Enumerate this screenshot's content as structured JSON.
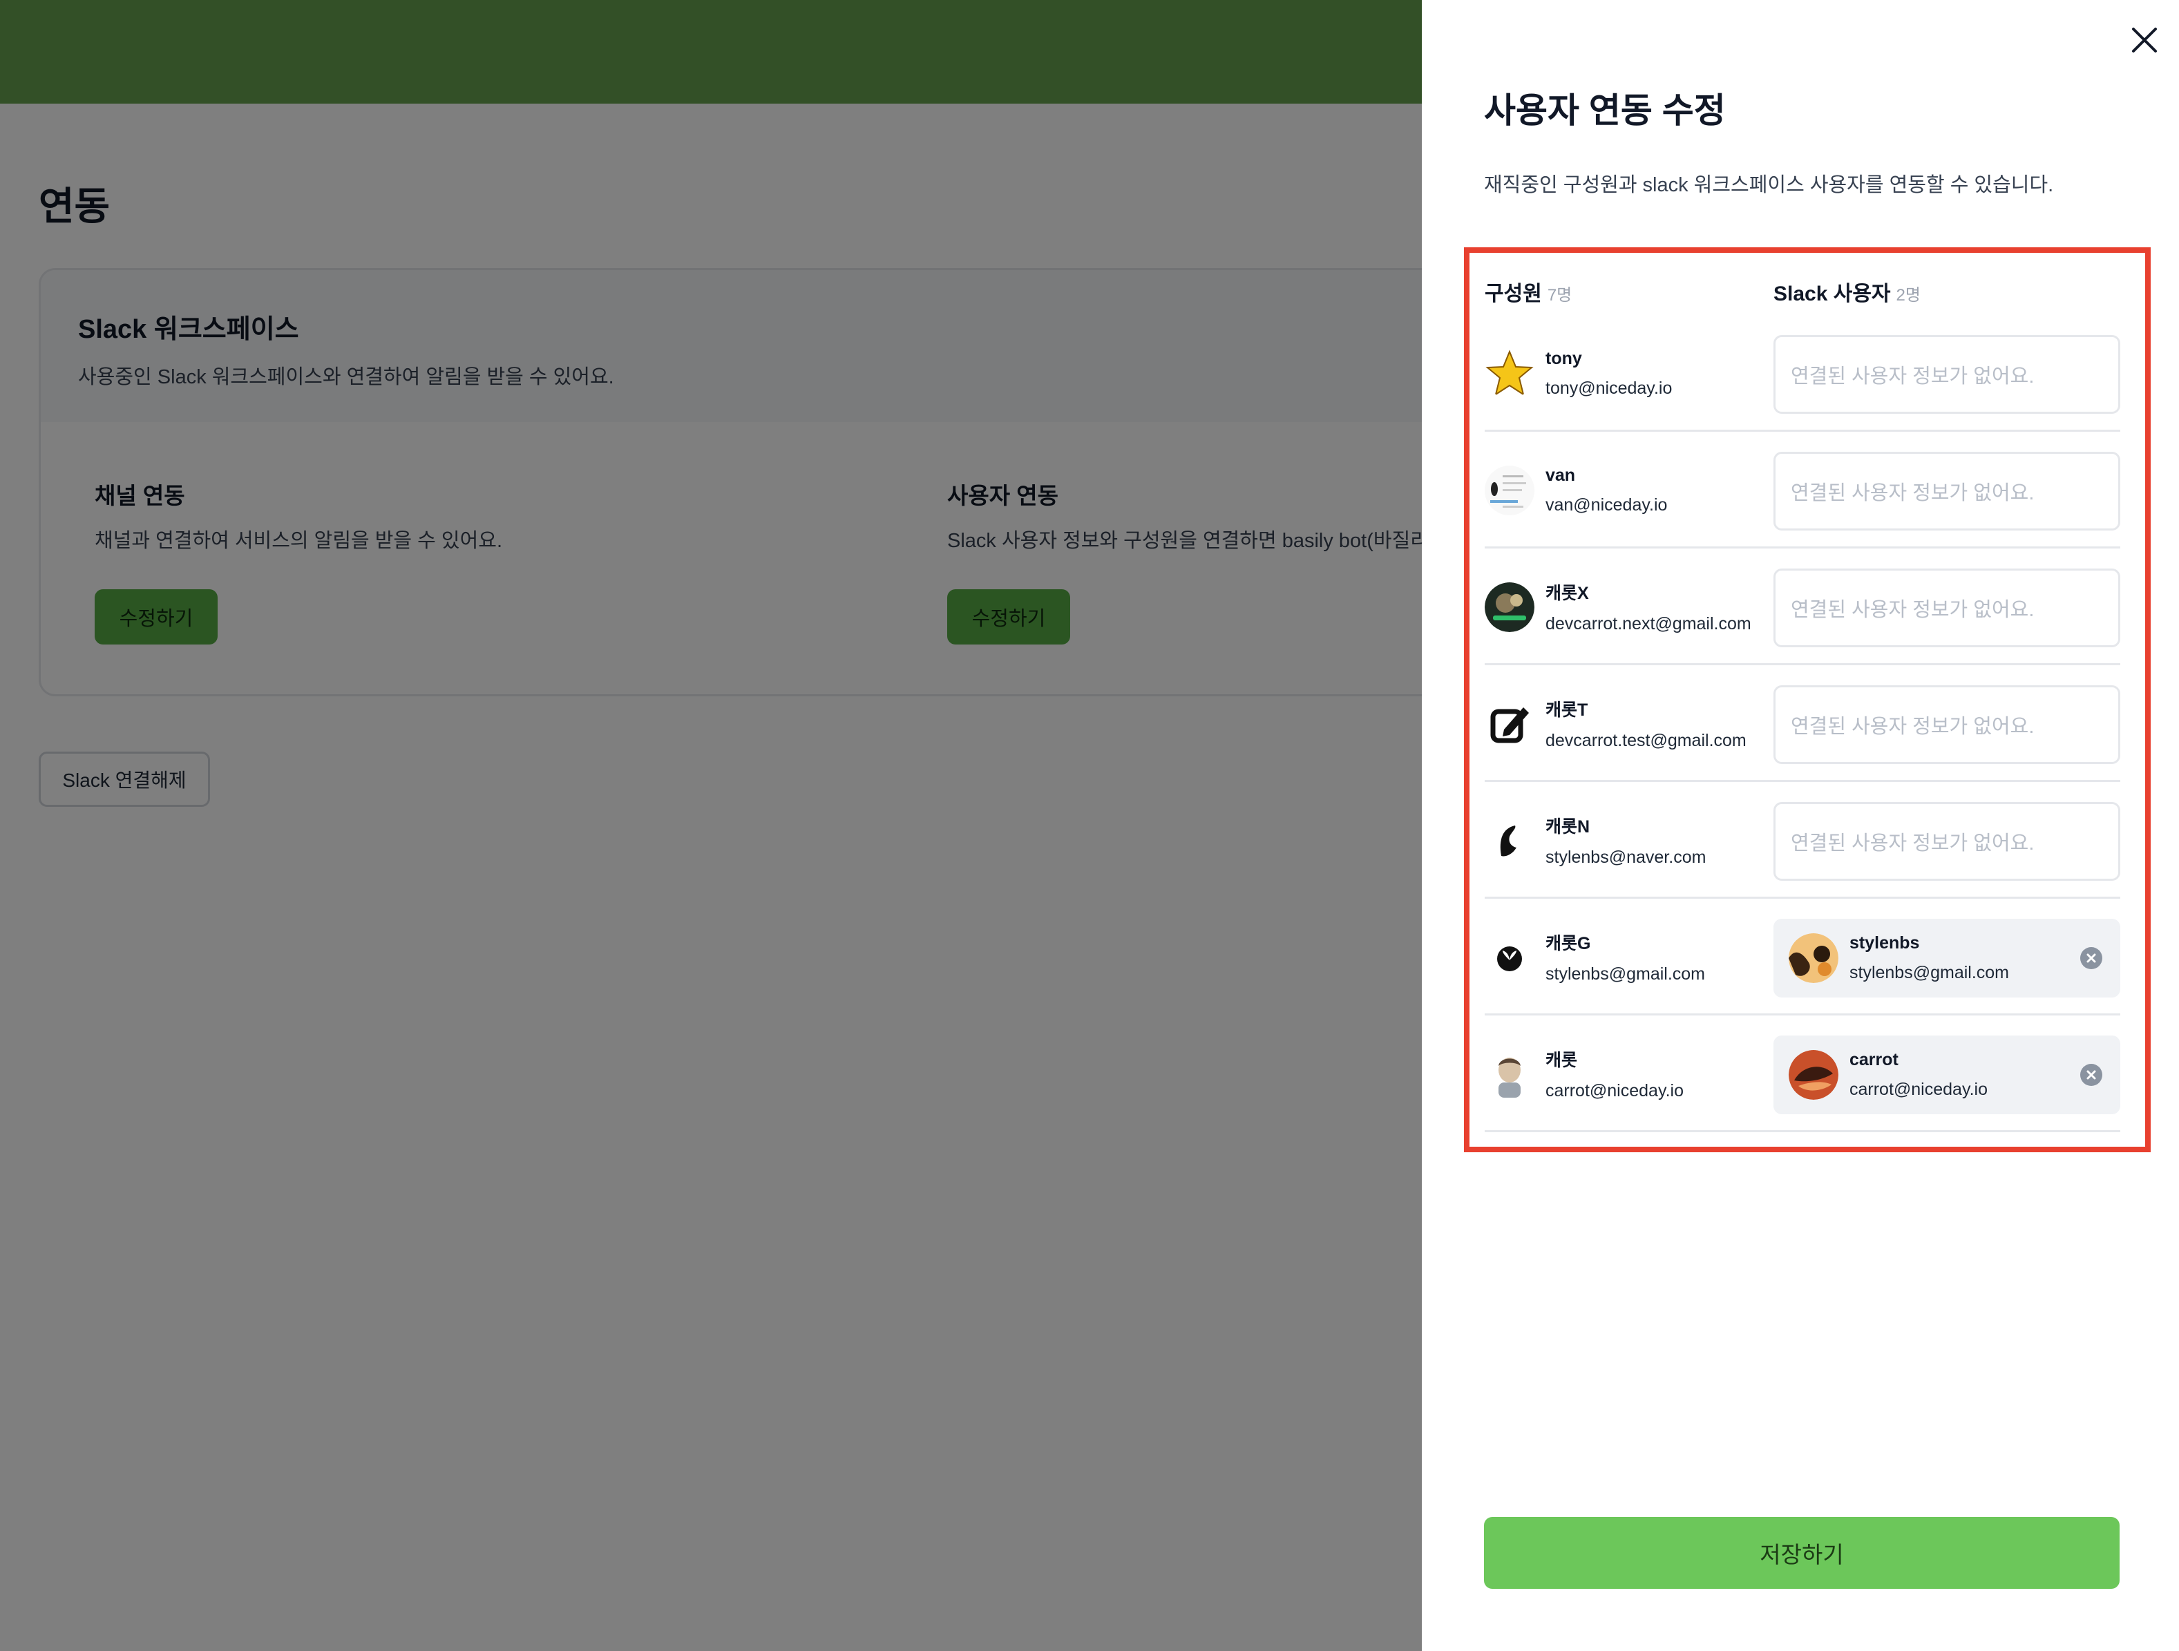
{
  "page": {
    "title": "연동",
    "workspace": {
      "title": "Slack 워크스페이스",
      "description": "사용중인 Slack 워크스페이스와 연결하여 알림을 받을 수 있어요."
    },
    "channel_link": {
      "title": "채널 연동",
      "description": "채널과 연결하여 서비스의 알림을 받을 수 있어요.",
      "button": "수정하기"
    },
    "user_link": {
      "title": "사용자 연동",
      "description": "Slack 사용자 정보와 구성원을 연결하면 basily bot(바질리",
      "button": "수정하기"
    },
    "disconnect_button": "Slack 연결해제"
  },
  "drawer": {
    "title": "사용자 연동 수정",
    "description": "재직중인 구성원과 slack 워크스페이스 사용자를 연동할 수 있습니다.",
    "members_header": "구성원",
    "members_count": "7명",
    "slack_header": "Slack 사용자",
    "slack_count": "2명",
    "placeholder": "연결된 사용자 정보가 없어요.",
    "save_button": "저장하기",
    "rows": [
      {
        "name": "tony",
        "email": "tony@niceday.io",
        "avatar": "star-icon",
        "linked": null
      },
      {
        "name": "van",
        "email": "van@niceday.io",
        "avatar": "document-thumbnail",
        "linked": null
      },
      {
        "name": "캐롯X",
        "email": "devcarrot.next@gmail.com",
        "avatar": "photo-avatar",
        "linked": null
      },
      {
        "name": "캐롯T",
        "email": "devcarrot.test@gmail.com",
        "avatar": "edit-square-icon",
        "linked": null
      },
      {
        "name": "캐롯N",
        "email": "stylenbs@naver.com",
        "avatar": "leaf-icon",
        "linked": null
      },
      {
        "name": "캐롯G",
        "email": "stylenbs@gmail.com",
        "avatar": "sprout-icon",
        "linked": {
          "name": "stylenbs",
          "email": "stylenbs@gmail.com",
          "avatar": "photo-avatar"
        }
      },
      {
        "name": "캐롯",
        "email": "carrot@niceday.io",
        "avatar": "person-avatar",
        "linked": {
          "name": "carrot",
          "email": "carrot@niceday.io",
          "avatar": "photo-avatar"
        }
      }
    ]
  },
  "colors": {
    "topbar": "#66a14f",
    "primary_button": "#6cc75a",
    "highlight_border": "#e8402f"
  }
}
